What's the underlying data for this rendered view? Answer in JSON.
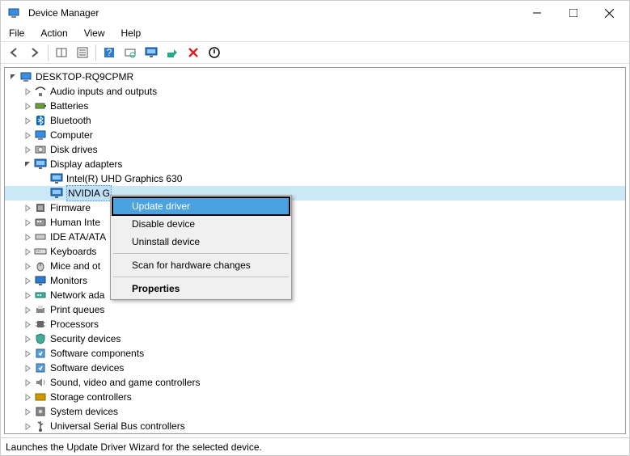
{
  "window": {
    "title": "Device Manager"
  },
  "menu": [
    "File",
    "Action",
    "View",
    "Help"
  ],
  "tree": {
    "root": "DESKTOP-RQ9CPMR",
    "nodes": [
      {
        "label": "Audio inputs and outputs",
        "icon": "audio"
      },
      {
        "label": "Batteries",
        "icon": "battery"
      },
      {
        "label": "Bluetooth",
        "icon": "bluetooth"
      },
      {
        "label": "Computer",
        "icon": "computer"
      },
      {
        "label": "Disk drives",
        "icon": "disk"
      },
      {
        "label": "Display adapters",
        "icon": "display",
        "expanded": true,
        "children": [
          {
            "label": "Intel(R) UHD Graphics 630",
            "icon": "display"
          },
          {
            "label": "NVIDIA G",
            "icon": "display",
            "selected": true
          }
        ]
      },
      {
        "label": "Firmware",
        "icon": "firmware"
      },
      {
        "label": "Human Inte",
        "icon": "hid"
      },
      {
        "label": "IDE ATA/ATA",
        "icon": "ide"
      },
      {
        "label": "Keyboards",
        "icon": "keyboard"
      },
      {
        "label": "Mice and ot",
        "icon": "mouse"
      },
      {
        "label": "Monitors",
        "icon": "monitor"
      },
      {
        "label": "Network ada",
        "icon": "network"
      },
      {
        "label": "Print queues",
        "icon": "printer"
      },
      {
        "label": "Processors",
        "icon": "cpu"
      },
      {
        "label": "Security devices",
        "icon": "security"
      },
      {
        "label": "Software components",
        "icon": "software"
      },
      {
        "label": "Software devices",
        "icon": "software"
      },
      {
        "label": "Sound, video and game controllers",
        "icon": "sound"
      },
      {
        "label": "Storage controllers",
        "icon": "storage"
      },
      {
        "label": "System devices",
        "icon": "system"
      },
      {
        "label": "Universal Serial Bus controllers",
        "icon": "usb"
      }
    ]
  },
  "context_menu": {
    "items": [
      {
        "label": "Update driver",
        "highlight": true
      },
      {
        "label": "Disable device"
      },
      {
        "label": "Uninstall device"
      },
      {
        "separator": true
      },
      {
        "label": "Scan for hardware changes"
      },
      {
        "separator": true
      },
      {
        "label": "Properties",
        "bold": true
      }
    ]
  },
  "status": "Launches the Update Driver Wizard for the selected device."
}
